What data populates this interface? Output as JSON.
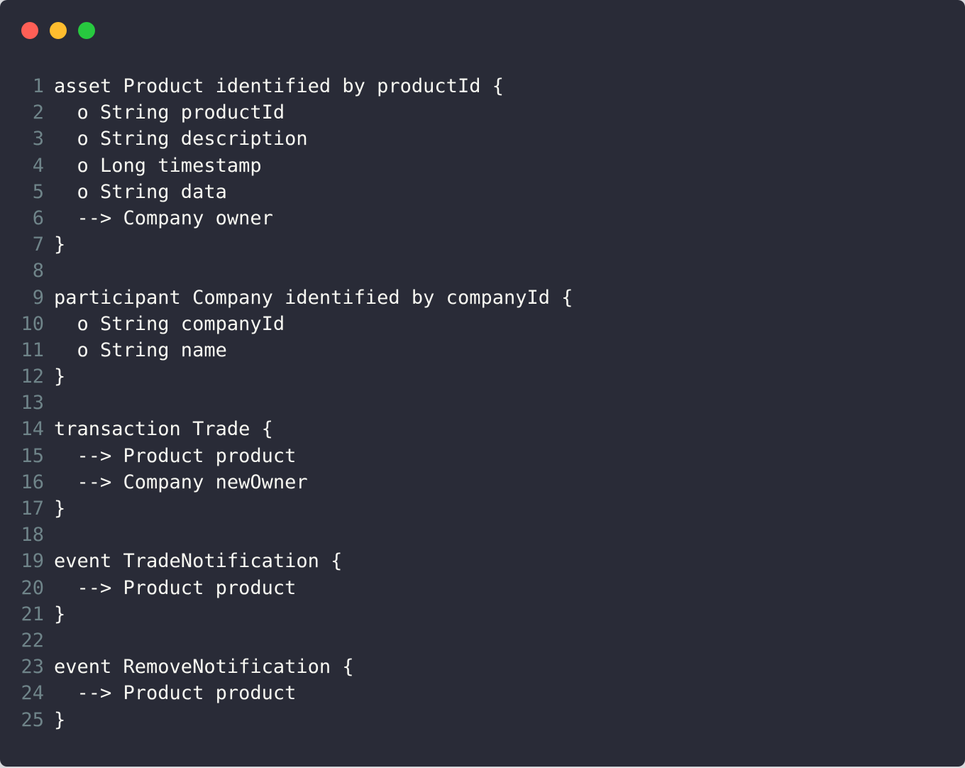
{
  "window": {
    "controls": {
      "close": {
        "icon": "close-dot-icon",
        "color": "#ff5f56"
      },
      "minimize": {
        "icon": "minimize-dot-icon",
        "color": "#ffbd2e"
      },
      "maximize": {
        "icon": "maximize-dot-icon",
        "color": "#27c93f"
      }
    }
  },
  "code": {
    "lines": [
      {
        "num": "1",
        "text": "asset Product identified by productId {"
      },
      {
        "num": "2",
        "text": "  o String productId"
      },
      {
        "num": "3",
        "text": "  o String description"
      },
      {
        "num": "4",
        "text": "  o Long timestamp"
      },
      {
        "num": "5",
        "text": "  o String data"
      },
      {
        "num": "6",
        "text": "  --> Company owner"
      },
      {
        "num": "7",
        "text": "}"
      },
      {
        "num": "8",
        "text": ""
      },
      {
        "num": "9",
        "text": "participant Company identified by companyId {"
      },
      {
        "num": "10",
        "text": "  o String companyId"
      },
      {
        "num": "11",
        "text": "  o String name"
      },
      {
        "num": "12",
        "text": "}"
      },
      {
        "num": "13",
        "text": ""
      },
      {
        "num": "14",
        "text": "transaction Trade {"
      },
      {
        "num": "15",
        "text": "  --> Product product"
      },
      {
        "num": "16",
        "text": "  --> Company newOwner"
      },
      {
        "num": "17",
        "text": "}"
      },
      {
        "num": "18",
        "text": ""
      },
      {
        "num": "19",
        "text": "event TradeNotification {"
      },
      {
        "num": "20",
        "text": "  --> Product product"
      },
      {
        "num": "21",
        "text": "}"
      },
      {
        "num": "22",
        "text": ""
      },
      {
        "num": "23",
        "text": "event RemoveNotification {"
      },
      {
        "num": "24",
        "text": "  --> Product product"
      },
      {
        "num": "25",
        "text": "}"
      }
    ]
  }
}
